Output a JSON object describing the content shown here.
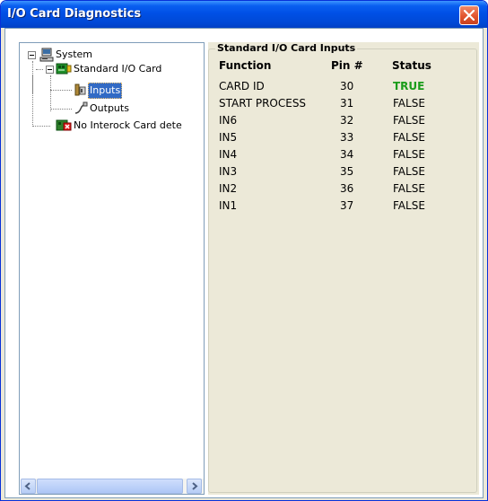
{
  "window": {
    "title": "I/O Card Diagnostics"
  },
  "tree": {
    "items": [
      {
        "label": "System",
        "icon": "computer-icon"
      },
      {
        "label": "Standard I/O Card",
        "icon": "io-card-icon"
      },
      {
        "label": "Inputs",
        "icon": "inputs-icon",
        "selected": true
      },
      {
        "label": "Outputs",
        "icon": "outputs-icon"
      },
      {
        "label": "No Interock Card dete",
        "icon": "interlock-card-error-icon"
      }
    ]
  },
  "panel": {
    "title": "Standard I/O Card Inputs",
    "columns": [
      "Function",
      "Pin #",
      "Status"
    ],
    "rows": [
      {
        "function": "CARD ID",
        "pin": "30",
        "status": "TRUE"
      },
      {
        "function": "START PROCESS",
        "pin": "31",
        "status": "FALSE"
      },
      {
        "function": "IN6",
        "pin": "32",
        "status": "FALSE"
      },
      {
        "function": "IN5",
        "pin": "33",
        "status": "FALSE"
      },
      {
        "function": "IN4",
        "pin": "34",
        "status": "FALSE"
      },
      {
        "function": "IN3",
        "pin": "35",
        "status": "FALSE"
      },
      {
        "function": "IN2",
        "pin": "36",
        "status": "FALSE"
      },
      {
        "function": "IN1",
        "pin": "37",
        "status": "FALSE"
      }
    ]
  },
  "colors": {
    "title_bar": "#0050e6",
    "close_button": "#e2552f",
    "status_true": "#1a9c1a",
    "selection": "#316ac5"
  }
}
